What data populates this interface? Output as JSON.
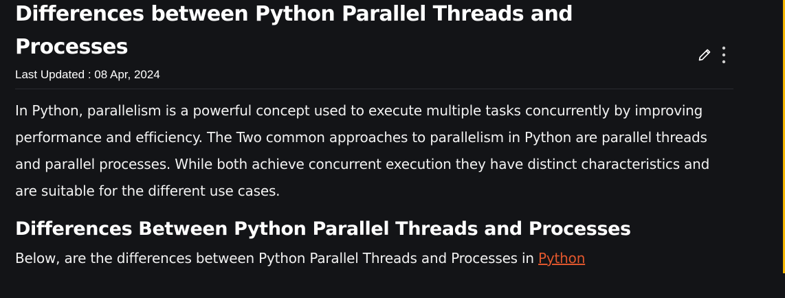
{
  "article": {
    "title": "Differences between Python Parallel Threads and Processes",
    "last_updated": "Last Updated : 08 Apr, 2024",
    "intro": "In Python, parallelism is a powerful concept used to execute multiple tasks concurrently by improving performance and efficiency. The Two common approaches to parallelism in Python are parallel threads and parallel processes. While both achieve concurrent execution they have distinct characteristics and are suitable for the different use cases.",
    "section_heading": "Differences Between Python Parallel Threads and Processes",
    "section_lead": "Below, are the differences between Python Parallel Threads and Processes in ",
    "section_link": "Python"
  },
  "icons": {
    "edit": "pencil-icon",
    "more": "kebab-menu-icon"
  },
  "colors": {
    "background": "#131417",
    "link": "#e2572d",
    "accent_rail": "#f6b700"
  }
}
